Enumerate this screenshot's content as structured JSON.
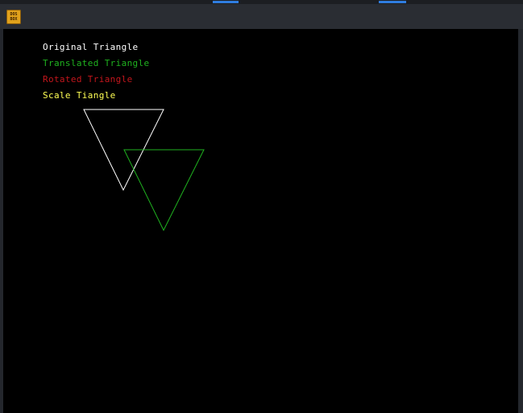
{
  "app": {
    "icon_name": "dosbox-icon",
    "icon_line1": "DOS",
    "icon_line2": "BOX"
  },
  "labels": [
    {
      "text": "Original Triangle",
      "color": "#ffffff"
    },
    {
      "text": "Translated Triangle",
      "color": "#1fb21f"
    },
    {
      "text": "Rotated Triangle",
      "color": "#c4161c"
    },
    {
      "text": "Scale Tiangle",
      "color": "#ffff54"
    }
  ],
  "colors": {
    "screen_bg": "#000000",
    "window_bg": "#24272d",
    "accent": "#2f7de1"
  }
}
